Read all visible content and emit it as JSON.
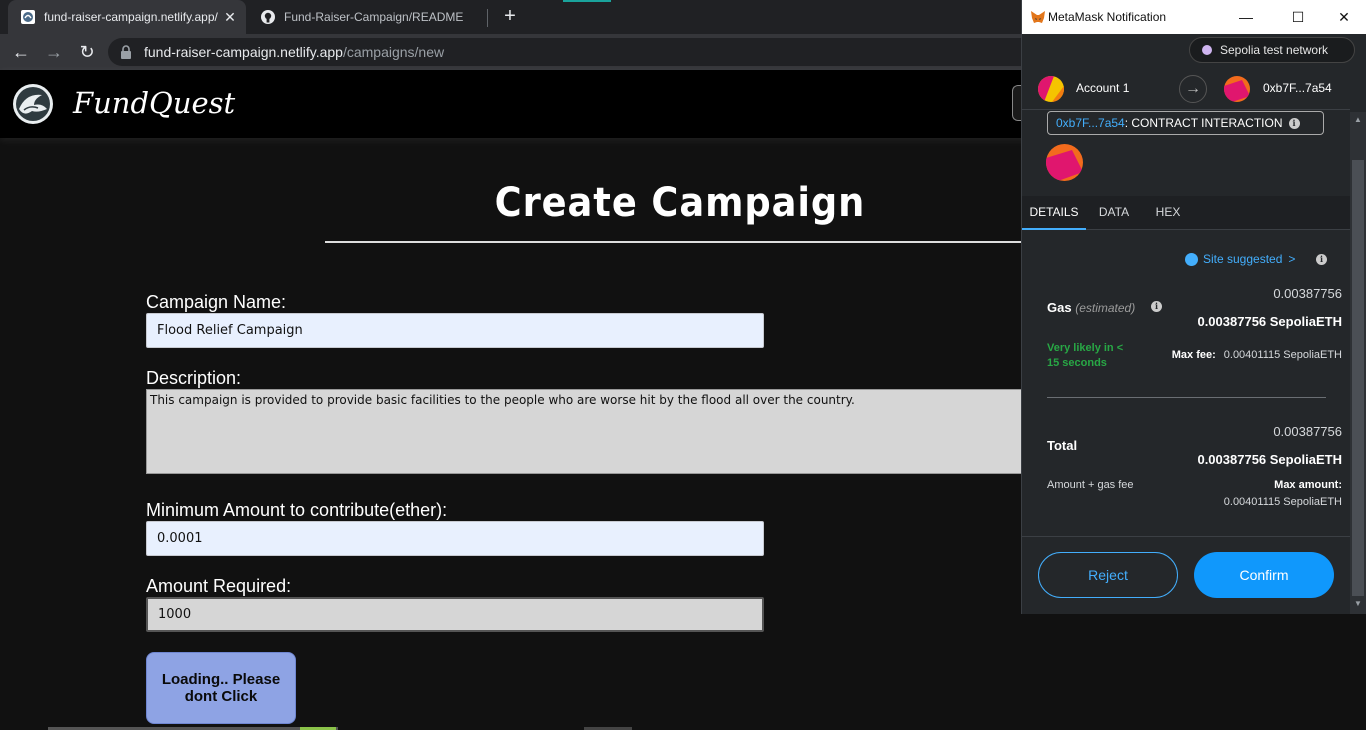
{
  "browser": {
    "tabs": [
      {
        "title": "fund-raiser-campaign.netlify.app/",
        "active": true,
        "close": "✕"
      },
      {
        "title": "Fund-Raiser-Campaign/README",
        "active": false
      }
    ],
    "new_tab": "+",
    "url_host": "fund-raiser-campaign.netlify.app",
    "url_path": "/campaigns/new",
    "back": "←",
    "forward": "→",
    "reload": "↻"
  },
  "site": {
    "brand": "FundQuest"
  },
  "form": {
    "title": "Create Campaign",
    "name_label": "Campaign Name:",
    "name_value": "Flood Relief Campaign",
    "desc_label": "Description:",
    "desc_value": "This campaign is provided to provide basic facilities to the people who are worse hit by the flood all over the country.",
    "min_label": "Minimum Amount to contribute(ether):",
    "min_value": "0.0001",
    "req_label": "Amount Required:",
    "req_value": "1000",
    "loading_button": "Loading.. Please dont Click"
  },
  "metamask": {
    "window_title": "MetaMask Notification",
    "minimize": "—",
    "maximize": "☐",
    "close": "✕",
    "network": "Sepolia test network",
    "account_name": "Account 1",
    "arrow": "→",
    "to_address": "0xb7F...7a54",
    "contract_address": "0xb7F...7a54",
    "contract_label": " : CONTRACT INTERACTION",
    "tabs": [
      "DETAILS",
      "DATA",
      "HEX"
    ],
    "site_suggested": "Site suggested",
    "site_chevron": ">",
    "gas_label": "Gas",
    "gas_estimated": "(estimated)",
    "gas_value": "0.00387756",
    "gas_value_eth": "0.00387756 SepoliaETH",
    "likely": "Very likely in < 15 seconds",
    "max_fee_label": "Max fee:",
    "max_fee_value": "0.00401115 SepoliaETH",
    "total_label": "Total",
    "total_value": "0.00387756",
    "total_value_eth": "0.00387756 SepoliaETH",
    "amount_gas": "Amount + gas fee",
    "max_amount_label": "Max amount:",
    "max_amount_value": "0.00401115 SepoliaETH",
    "reject": "Reject",
    "confirm": "Confirm",
    "info_glyph": "i",
    "scroll_up": "▲",
    "scroll_down": "▼"
  },
  "colors": {
    "accent": "#43aefc",
    "confirm": "#1098fc",
    "likely_green": "#28a745",
    "loading_button": "#8ea3e4"
  }
}
